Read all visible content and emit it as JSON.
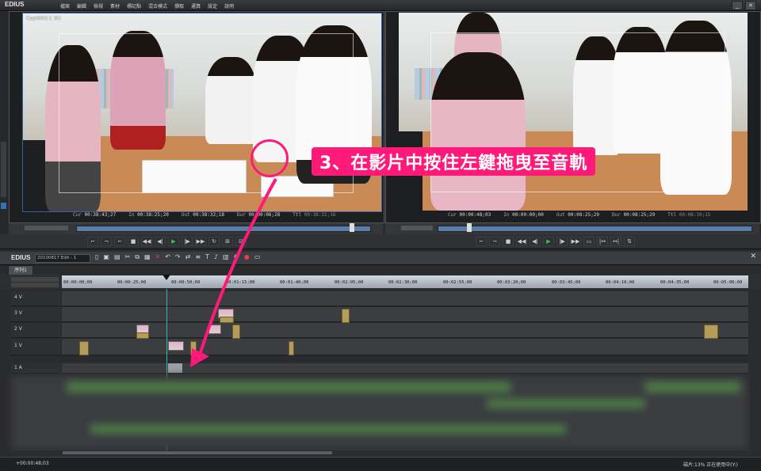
{
  "app": {
    "title": "EDIUS"
  },
  "menu": [
    "檔案",
    "編輯",
    "檢視",
    "素材",
    "標記點",
    "混合模式",
    "擷取",
    "遷算",
    "設定",
    "說明"
  ],
  "player": {
    "overlay_label": "Cap0002-1 (R)",
    "timecode": {
      "cur_label": "Cur",
      "cur": "00:38:43;27",
      "in_label": "In",
      "in": "00:38:25;20",
      "out_label": "Out",
      "out": "00:38:32;18",
      "dur_label": "Dur",
      "dur": "00:00:06;28",
      "ttl_label": "Ttl",
      "ttl": "00:38:31;16"
    }
  },
  "recorder": {
    "timecode": {
      "cur_label": "Cur",
      "cur": "00:00:48;03",
      "in_label": "In",
      "in": "00:00:00;00",
      "out_label": "Out",
      "out": "00:08:25;29",
      "dur_label": "Dur",
      "dur": "00:08:25;29",
      "ttl_label": "Ttl",
      "ttl": "00:08:39;15"
    }
  },
  "timeline": {
    "logo": "EDIUS",
    "project": "20100817 Edit - 1",
    "sequence_tab": "序列1",
    "ruler_ticks": [
      "00:00:00;00",
      "00:00:25;00",
      "00:00:50;00",
      "00:01:15;00",
      "00:01:40;00",
      "00:02:05;00",
      "00:02:30;00",
      "00:02:55;00",
      "00:03:20;00",
      "00:03:45;00",
      "00:04:10;00",
      "00:04:35;00",
      "00:05:00;00"
    ],
    "tracks": [
      {
        "label": "4 V"
      },
      {
        "label": "3 V"
      },
      {
        "label": "2 V"
      },
      {
        "label": "1 V"
      },
      {
        "label": "1 A"
      }
    ]
  },
  "annotation": {
    "caption": "3、在影片中按住左鍵拖曳至音軌",
    "color": "#ff1a7a"
  },
  "status": {
    "left": "+00:00:48;03",
    "right": "磁片:13% 正在使用中(Y:)"
  }
}
